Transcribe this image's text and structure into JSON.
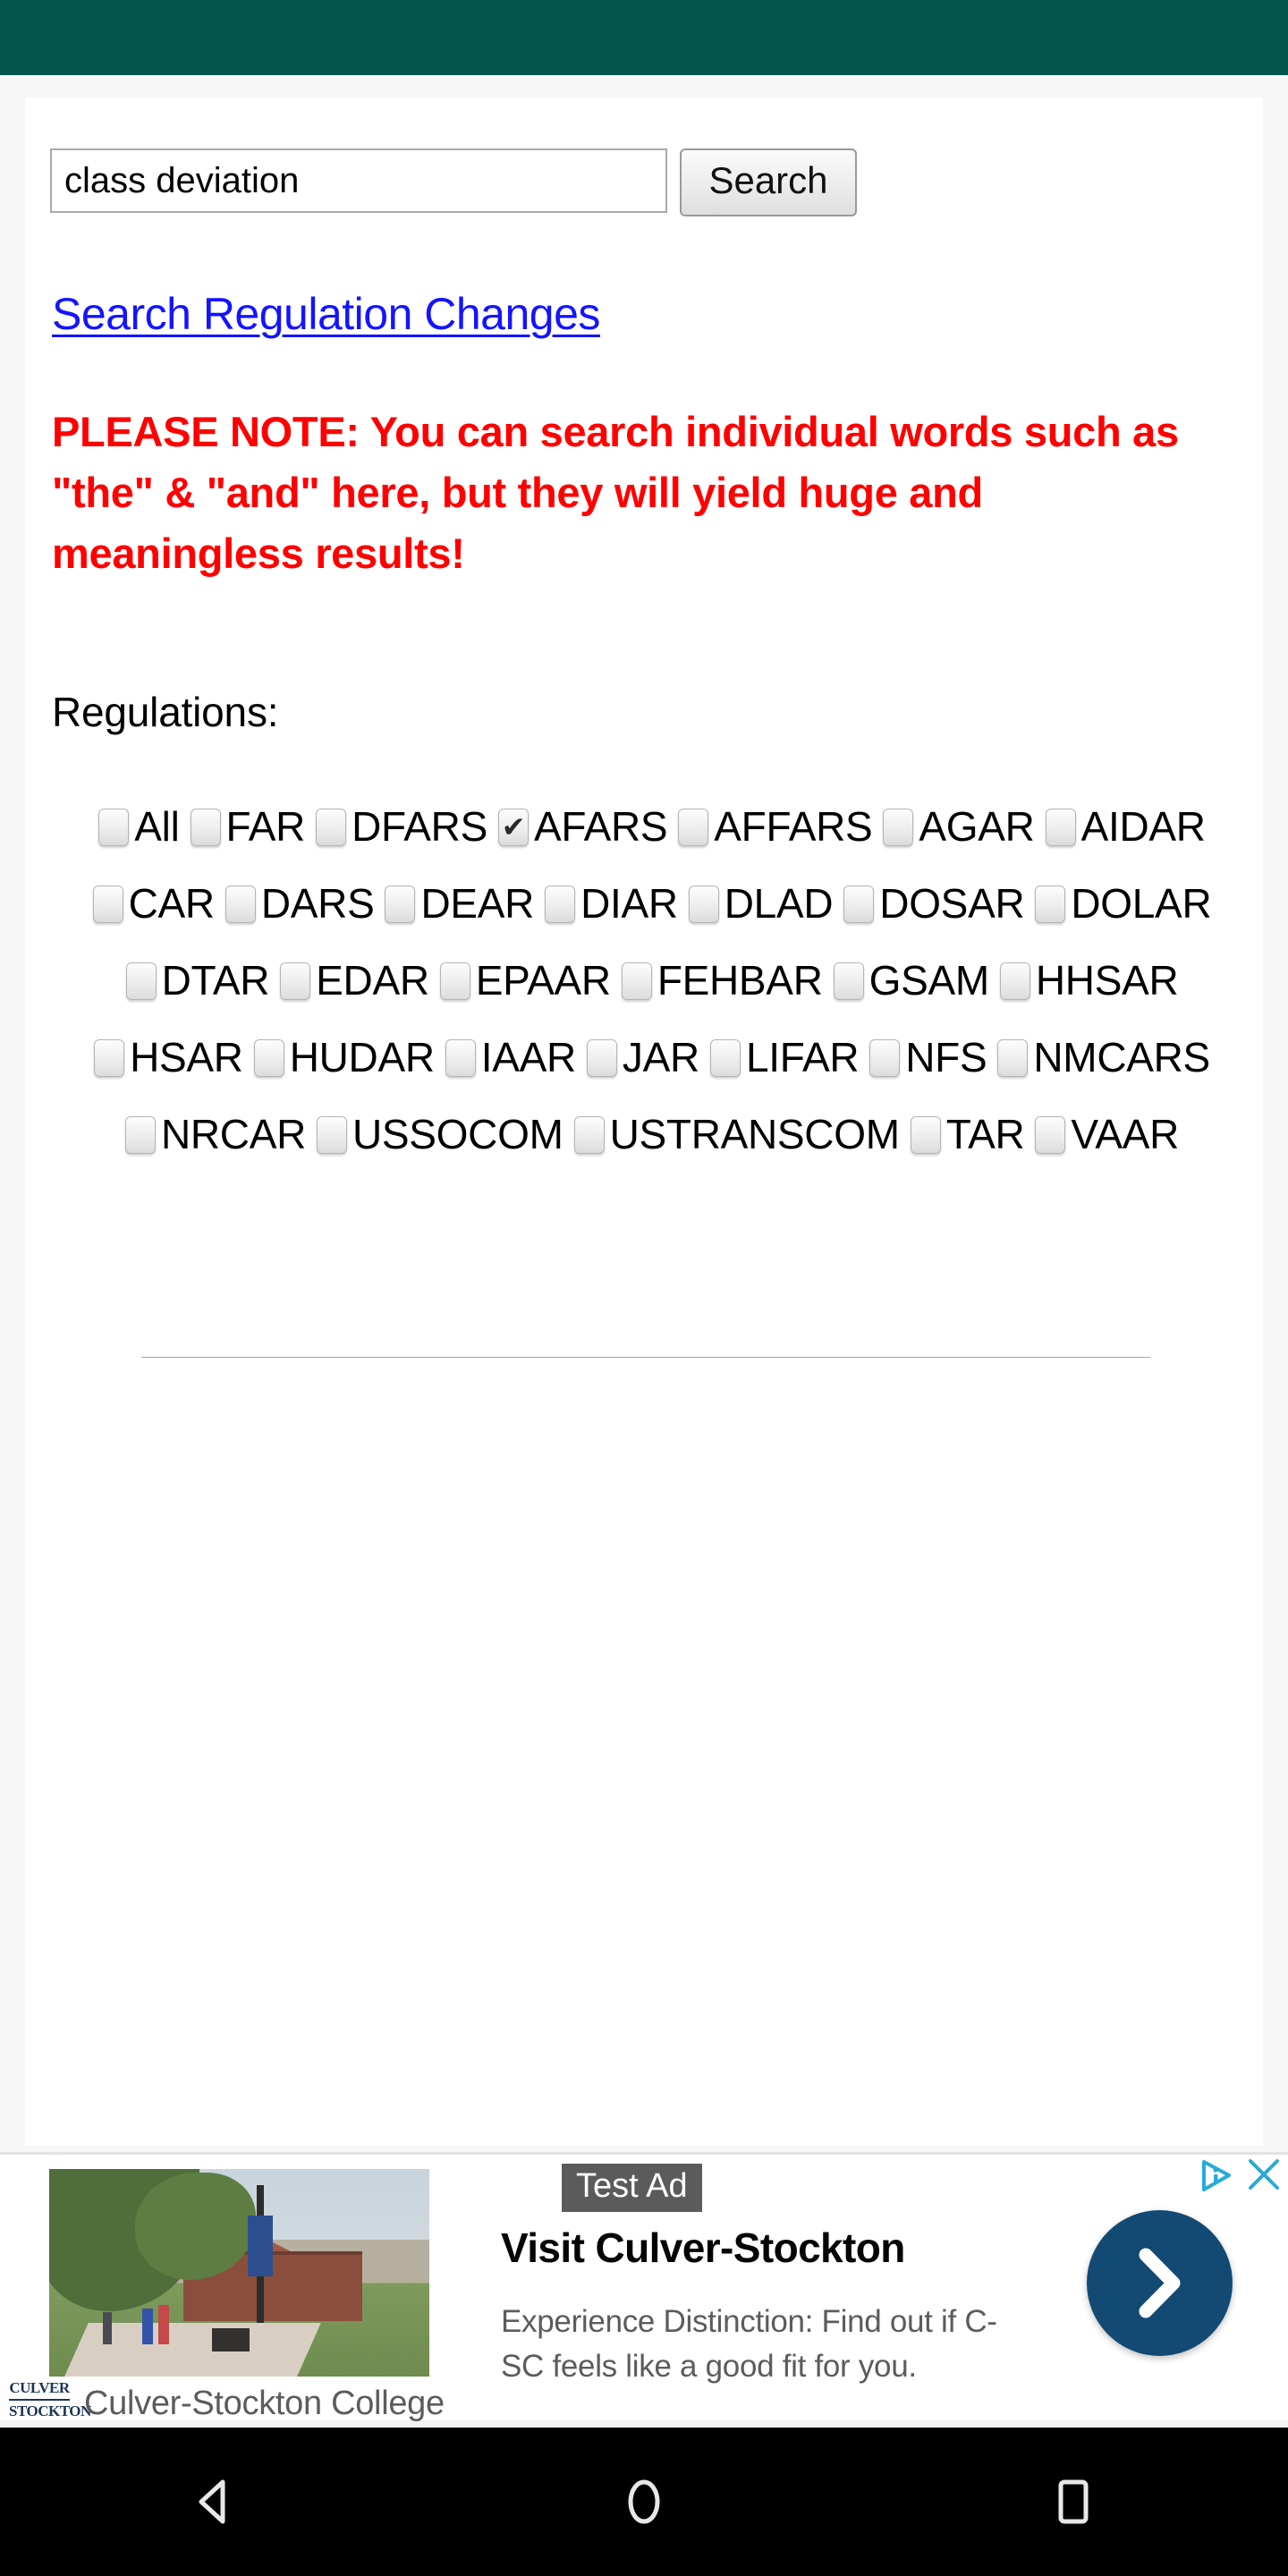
{
  "topbar": {
    "color": "#00554c"
  },
  "search": {
    "value": "class deviation",
    "placeholder": "",
    "button_label": "Search"
  },
  "links": {
    "regulation_changes": "Search Regulation Changes"
  },
  "notice": {
    "text": "PLEASE NOTE: You can search individual words such as \"the\" & \"and\" here, but they will yield huge and meaningless results!",
    "color": "#fe0000"
  },
  "regulations": {
    "heading": "Regulations:",
    "options": [
      {
        "label": "All",
        "checked": false
      },
      {
        "label": "FAR",
        "checked": false
      },
      {
        "label": "DFARS",
        "checked": false
      },
      {
        "label": "AFARS",
        "checked": true
      },
      {
        "label": "AFFARS",
        "checked": false
      },
      {
        "label": "AGAR",
        "checked": false
      },
      {
        "label": "AIDAR",
        "checked": false
      },
      {
        "label": "CAR",
        "checked": false
      },
      {
        "label": "DARS",
        "checked": false
      },
      {
        "label": "DEAR",
        "checked": false
      },
      {
        "label": "DIAR",
        "checked": false
      },
      {
        "label": "DLAD",
        "checked": false
      },
      {
        "label": "DOSAR",
        "checked": false
      },
      {
        "label": "DOLAR",
        "checked": false
      },
      {
        "label": "DTAR",
        "checked": false
      },
      {
        "label": "EDAR",
        "checked": false
      },
      {
        "label": "EPAAR",
        "checked": false
      },
      {
        "label": "FEHBAR",
        "checked": false
      },
      {
        "label": "GSAM",
        "checked": false
      },
      {
        "label": "HHSAR",
        "checked": false
      },
      {
        "label": "HSAR",
        "checked": false
      },
      {
        "label": "HUDAR",
        "checked": false
      },
      {
        "label": "IAAR",
        "checked": false
      },
      {
        "label": "JAR",
        "checked": false
      },
      {
        "label": "LIFAR",
        "checked": false
      },
      {
        "label": "NFS",
        "checked": false
      },
      {
        "label": "NMCARS",
        "checked": false
      },
      {
        "label": "NRCAR",
        "checked": false
      },
      {
        "label": "USSOCOM",
        "checked": false
      },
      {
        "label": "USTRANSCOM",
        "checked": false
      },
      {
        "label": "TAR",
        "checked": false
      },
      {
        "label": "VAAR",
        "checked": false
      }
    ]
  },
  "ad": {
    "badge": "Test Ad",
    "headline": "Visit Culver-Stockton",
    "description": "Experience Distinction: Find out if C-SC feels like a good fit for you.",
    "advertiser": "Culver-Stockton College",
    "logo_line1": "CULVER",
    "logo_line2": "STOCKTON",
    "cta_icon": "chevron-right-icon",
    "adchoices_icon": "adchoices-icon",
    "close_icon": "close-icon",
    "cta_color": "#134a73",
    "accent_color": "#29abd6"
  },
  "navbar": {
    "back": "back-button",
    "home": "home-button",
    "recents": "recents-button"
  }
}
